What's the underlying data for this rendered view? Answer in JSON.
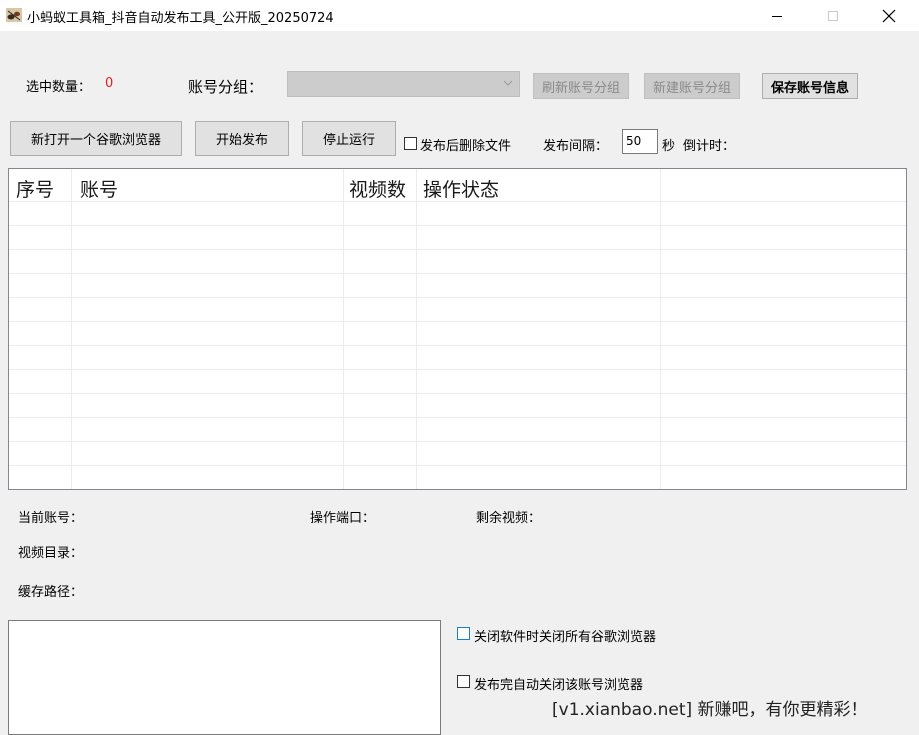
{
  "window": {
    "title": "小蚂蚁工具箱_抖音自动发布工具_公开版_20250724",
    "icon": "ant-app-icon"
  },
  "top": {
    "selected_label": "选中数量：",
    "selected_count": "0",
    "group_label": "账号分组：",
    "group_value": "",
    "refresh_group_button": "刷新账号分组",
    "new_group_button": "新建账号分组",
    "save_account_button": "保存账号信息"
  },
  "toolbar": {
    "open_browser_button": "新打开一个谷歌浏览器",
    "start_button": "开始发布",
    "stop_button": "停止运行",
    "delete_after_publish_label": "发布后删除文件",
    "interval_label": "发布间隔：",
    "interval_value": "50",
    "seconds_label": "秒",
    "countdown_label": "倒计时："
  },
  "table": {
    "columns": [
      "序号",
      "账号",
      "视频数",
      "操作状态"
    ],
    "rows": []
  },
  "info": {
    "current_account_label": "当前账号：",
    "port_label": "操作端口：",
    "remaining_label": "剩余视频：",
    "video_dir_label": "视频目录：",
    "cache_path_label": "缓存路径："
  },
  "options": {
    "close_all_browsers_label": "关闭软件时关闭所有谷歌浏览器",
    "auto_close_browser_label": "发布完自动关闭该账号浏览器"
  },
  "log": {
    "text": ""
  },
  "watermark": "[v1.xianbao.net] 新赚吧，有你更精彩！",
  "colors": {
    "accent_red": "#e0201c",
    "checkbox_blue": "#1a7fd6"
  }
}
